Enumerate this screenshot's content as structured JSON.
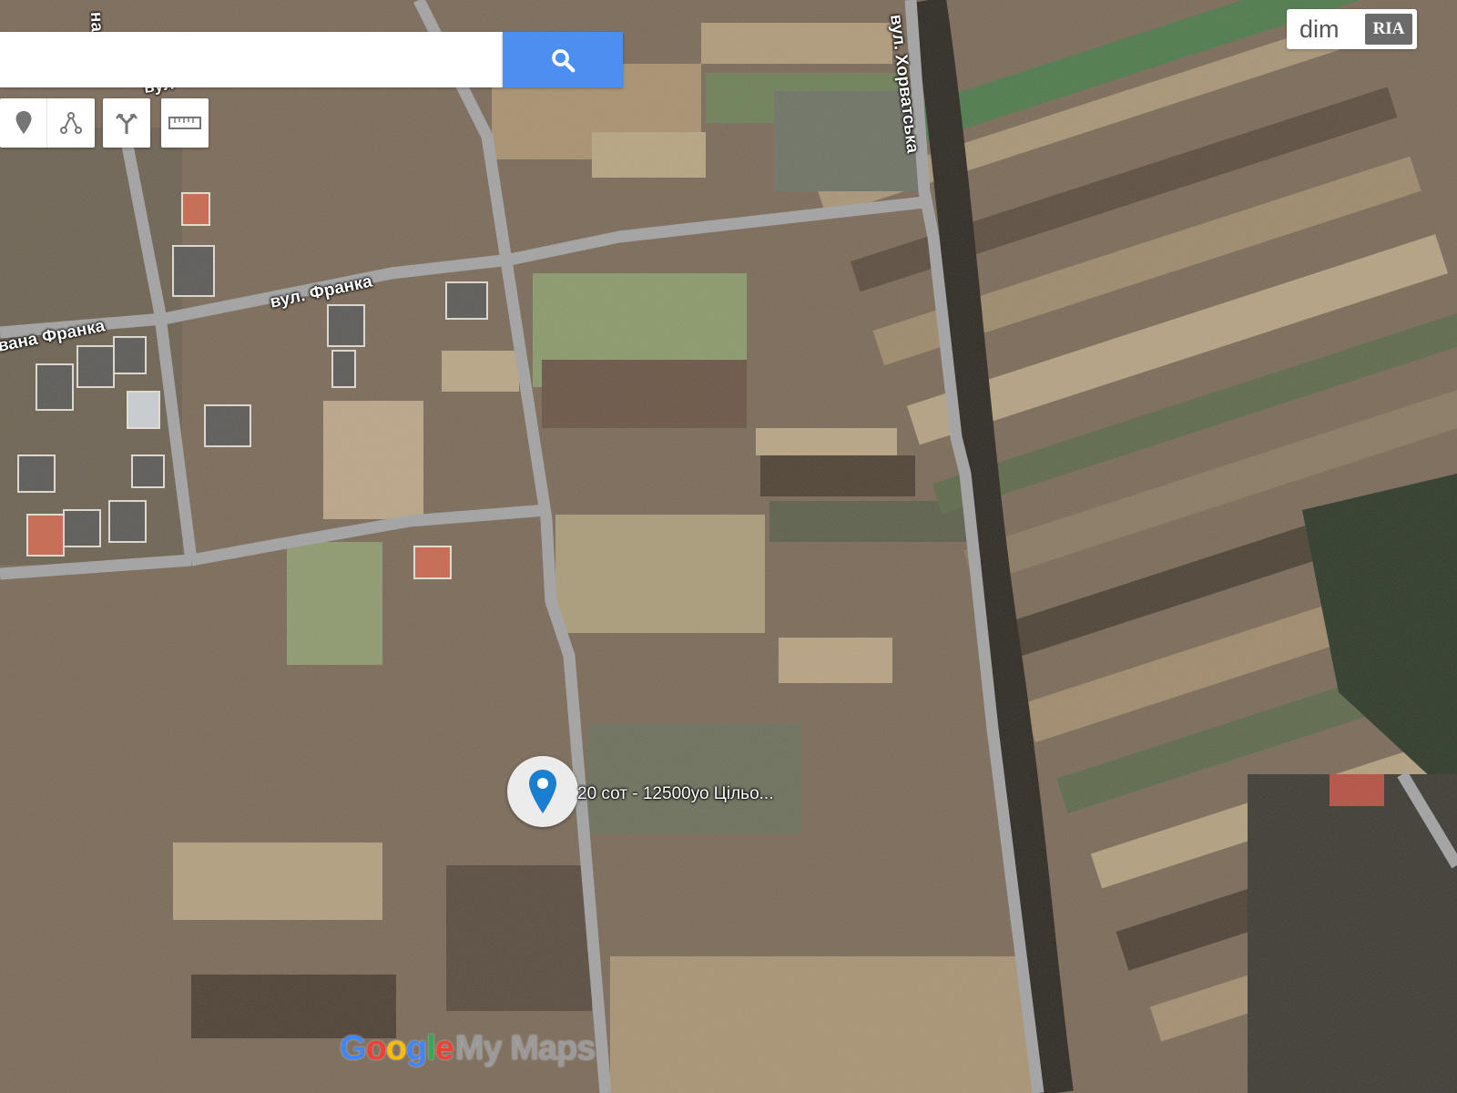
{
  "search": {
    "value": "",
    "placeholder": ""
  },
  "toolbar": {
    "tools": [
      "marker-icon",
      "line-icon",
      "directions-icon",
      "ruler-icon"
    ]
  },
  "road_labels": {
    "khorvatska": "вул. Хорватська",
    "franka": "вул. Франка",
    "ivana_franka": "вана Франка",
    "top_partial": "на",
    "top_partial2": "вул"
  },
  "marker": {
    "label": "20 сот - 12500уо Цільо..."
  },
  "branding": {
    "dim": "dim",
    "ria": "RIA",
    "google_letters": [
      "G",
      "o",
      "o",
      "g",
      "l",
      "e"
    ],
    "google_colors": [
      "#4285f4",
      "#ea4335",
      "#fbbc05",
      "#4285f4",
      "#34a853",
      "#ea4335"
    ],
    "mymaps": "My Maps"
  },
  "colors": {
    "search_button": "#4d8ff0",
    "marker_pin": "#1a7fd0",
    "road": "#a3a3a3"
  }
}
